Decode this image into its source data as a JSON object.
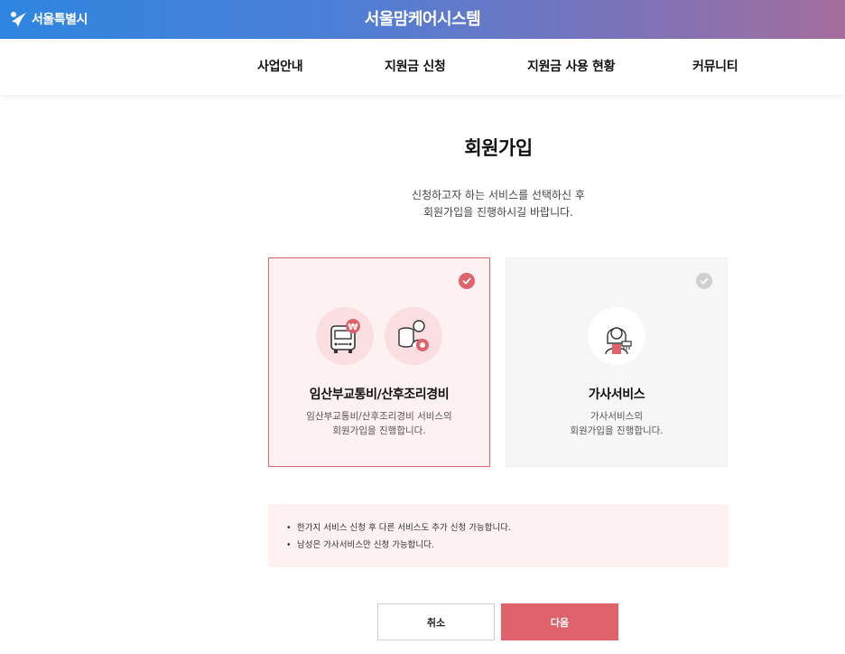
{
  "header": {
    "logo_text": "서울특별시",
    "site_title": "서울맘케어시스템"
  },
  "nav": {
    "items": [
      {
        "label": "사업안내"
      },
      {
        "label": "지원금 신청"
      },
      {
        "label": "지원금 사용 현황"
      },
      {
        "label": "커뮤니티"
      }
    ]
  },
  "main": {
    "title": "회원가입",
    "description_line1": "신청하고자 하는 서비스를 선택하신 후",
    "description_line2": "회원가입을 진행하시길 바랍니다.",
    "cards": [
      {
        "title": "임산부교통비/산후조리경비",
        "desc_line1": "임산부교통비/산후조리경비 서비스의",
        "desc_line2": "회원가입을 진행합니다.",
        "selected": true,
        "icons": [
          "bus-won-icon",
          "mother-coins-icon"
        ]
      },
      {
        "title": "가사서비스",
        "desc_line1": "가사서비스의",
        "desc_line2": "회원가입을 진행합니다.",
        "selected": false,
        "icons": [
          "housekeeper-icon"
        ]
      }
    ],
    "notices": [
      "한가지 서비스 신청 후 다른 서비스도 추가 신청 가능합니다.",
      "남성은 가사서비스만 신청 가능합니다."
    ],
    "notice_bullet": "•",
    "buttons": {
      "cancel": "취소",
      "next": "다음"
    }
  },
  "colors": {
    "accent": "#e0636c",
    "card_selected_bg": "#fdf1f2",
    "card_unselected_bg": "#f6f6f6",
    "header_gradient_start": "#2e86e0",
    "header_gradient_end": "#a56e9c"
  }
}
